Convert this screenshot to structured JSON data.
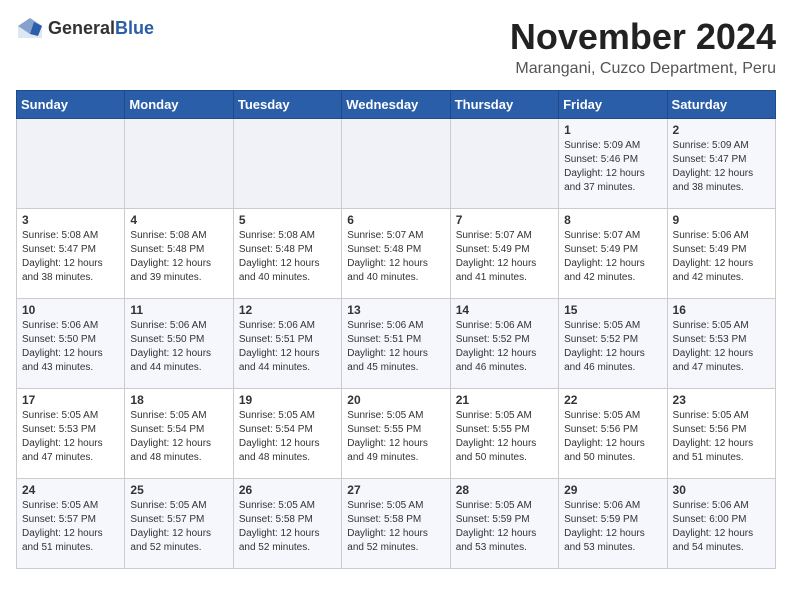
{
  "header": {
    "logo_general": "General",
    "logo_blue": "Blue",
    "title": "November 2024",
    "subtitle": "Marangani, Cuzco Department, Peru"
  },
  "weekdays": [
    "Sunday",
    "Monday",
    "Tuesday",
    "Wednesday",
    "Thursday",
    "Friday",
    "Saturday"
  ],
  "weeks": [
    [
      {
        "day": "",
        "info": ""
      },
      {
        "day": "",
        "info": ""
      },
      {
        "day": "",
        "info": ""
      },
      {
        "day": "",
        "info": ""
      },
      {
        "day": "",
        "info": ""
      },
      {
        "day": "1",
        "info": "Sunrise: 5:09 AM\nSunset: 5:46 PM\nDaylight: 12 hours\nand 37 minutes."
      },
      {
        "day": "2",
        "info": "Sunrise: 5:09 AM\nSunset: 5:47 PM\nDaylight: 12 hours\nand 38 minutes."
      }
    ],
    [
      {
        "day": "3",
        "info": "Sunrise: 5:08 AM\nSunset: 5:47 PM\nDaylight: 12 hours\nand 38 minutes."
      },
      {
        "day": "4",
        "info": "Sunrise: 5:08 AM\nSunset: 5:48 PM\nDaylight: 12 hours\nand 39 minutes."
      },
      {
        "day": "5",
        "info": "Sunrise: 5:08 AM\nSunset: 5:48 PM\nDaylight: 12 hours\nand 40 minutes."
      },
      {
        "day": "6",
        "info": "Sunrise: 5:07 AM\nSunset: 5:48 PM\nDaylight: 12 hours\nand 40 minutes."
      },
      {
        "day": "7",
        "info": "Sunrise: 5:07 AM\nSunset: 5:49 PM\nDaylight: 12 hours\nand 41 minutes."
      },
      {
        "day": "8",
        "info": "Sunrise: 5:07 AM\nSunset: 5:49 PM\nDaylight: 12 hours\nand 42 minutes."
      },
      {
        "day": "9",
        "info": "Sunrise: 5:06 AM\nSunset: 5:49 PM\nDaylight: 12 hours\nand 42 minutes."
      }
    ],
    [
      {
        "day": "10",
        "info": "Sunrise: 5:06 AM\nSunset: 5:50 PM\nDaylight: 12 hours\nand 43 minutes."
      },
      {
        "day": "11",
        "info": "Sunrise: 5:06 AM\nSunset: 5:50 PM\nDaylight: 12 hours\nand 44 minutes."
      },
      {
        "day": "12",
        "info": "Sunrise: 5:06 AM\nSunset: 5:51 PM\nDaylight: 12 hours\nand 44 minutes."
      },
      {
        "day": "13",
        "info": "Sunrise: 5:06 AM\nSunset: 5:51 PM\nDaylight: 12 hours\nand 45 minutes."
      },
      {
        "day": "14",
        "info": "Sunrise: 5:06 AM\nSunset: 5:52 PM\nDaylight: 12 hours\nand 46 minutes."
      },
      {
        "day": "15",
        "info": "Sunrise: 5:05 AM\nSunset: 5:52 PM\nDaylight: 12 hours\nand 46 minutes."
      },
      {
        "day": "16",
        "info": "Sunrise: 5:05 AM\nSunset: 5:53 PM\nDaylight: 12 hours\nand 47 minutes."
      }
    ],
    [
      {
        "day": "17",
        "info": "Sunrise: 5:05 AM\nSunset: 5:53 PM\nDaylight: 12 hours\nand 47 minutes."
      },
      {
        "day": "18",
        "info": "Sunrise: 5:05 AM\nSunset: 5:54 PM\nDaylight: 12 hours\nand 48 minutes."
      },
      {
        "day": "19",
        "info": "Sunrise: 5:05 AM\nSunset: 5:54 PM\nDaylight: 12 hours\nand 48 minutes."
      },
      {
        "day": "20",
        "info": "Sunrise: 5:05 AM\nSunset: 5:55 PM\nDaylight: 12 hours\nand 49 minutes."
      },
      {
        "day": "21",
        "info": "Sunrise: 5:05 AM\nSunset: 5:55 PM\nDaylight: 12 hours\nand 50 minutes."
      },
      {
        "day": "22",
        "info": "Sunrise: 5:05 AM\nSunset: 5:56 PM\nDaylight: 12 hours\nand 50 minutes."
      },
      {
        "day": "23",
        "info": "Sunrise: 5:05 AM\nSunset: 5:56 PM\nDaylight: 12 hours\nand 51 minutes."
      }
    ],
    [
      {
        "day": "24",
        "info": "Sunrise: 5:05 AM\nSunset: 5:57 PM\nDaylight: 12 hours\nand 51 minutes."
      },
      {
        "day": "25",
        "info": "Sunrise: 5:05 AM\nSunset: 5:57 PM\nDaylight: 12 hours\nand 52 minutes."
      },
      {
        "day": "26",
        "info": "Sunrise: 5:05 AM\nSunset: 5:58 PM\nDaylight: 12 hours\nand 52 minutes."
      },
      {
        "day": "27",
        "info": "Sunrise: 5:05 AM\nSunset: 5:58 PM\nDaylight: 12 hours\nand 52 minutes."
      },
      {
        "day": "28",
        "info": "Sunrise: 5:05 AM\nSunset: 5:59 PM\nDaylight: 12 hours\nand 53 minutes."
      },
      {
        "day": "29",
        "info": "Sunrise: 5:06 AM\nSunset: 5:59 PM\nDaylight: 12 hours\nand 53 minutes."
      },
      {
        "day": "30",
        "info": "Sunrise: 5:06 AM\nSunset: 6:00 PM\nDaylight: 12 hours\nand 54 minutes."
      }
    ]
  ]
}
